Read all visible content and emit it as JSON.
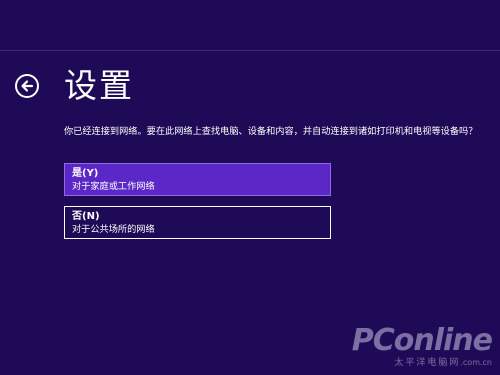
{
  "header": {
    "title": "设置",
    "back_icon": "arrow-left-icon"
  },
  "network": {
    "question": "你已经连接到网络。要在此网络上查找电脑、设备和内容，并自动连接到诸如打印机和电视等设备吗？",
    "options": [
      {
        "title": "是(Y)",
        "description": "对于家庭或工作网络",
        "selected": true
      },
      {
        "title": "否(N)",
        "description": "对于公共场所的网络",
        "selected": false
      }
    ]
  },
  "watermark": {
    "logo": "PConline",
    "subtitle": "太平洋电脑网",
    "url": ".com.cn"
  },
  "colors": {
    "background": "#1e0a56",
    "selected_option": "#5b27c7",
    "text": "#ffffff"
  }
}
